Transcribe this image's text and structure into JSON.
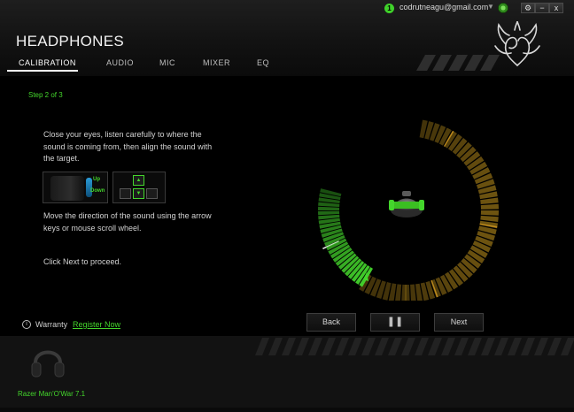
{
  "account": {
    "badge": "1",
    "email": "codrutneagu@gmail.com",
    "caret": "▼"
  },
  "window_controls": {
    "settings": "⚙",
    "minimize": "−",
    "close": "x"
  },
  "header": {
    "title": "HEADPHONES"
  },
  "nav": {
    "tabs": [
      {
        "label": "CALIBRATION",
        "active": true
      },
      {
        "label": "AUDIO"
      },
      {
        "label": "MIC"
      },
      {
        "label": "MIXER"
      },
      {
        "label": "EQ"
      }
    ]
  },
  "calibration": {
    "step": "Step 2 of 3",
    "instructions": "Close your eyes, listen carefully to where the sound is coming from, then align the sound with the target.",
    "scroll_up": "Up",
    "scroll_down": "Down",
    "direction_hint": "Move the direction of the sound using the arrow keys or mouse scroll wheel.",
    "proceed_hint": "Click Next to proceed."
  },
  "buttons": {
    "back": "Back",
    "pause": "❚❚",
    "next": "Next"
  },
  "footer": {
    "warranty_label": "Warranty",
    "register_link": "Register Now"
  },
  "device": {
    "name": "Razer Man'O'War 7.1"
  },
  "colors": {
    "accent": "#44d62c",
    "dial_amber": "#7a5d12",
    "background": "#000000"
  }
}
